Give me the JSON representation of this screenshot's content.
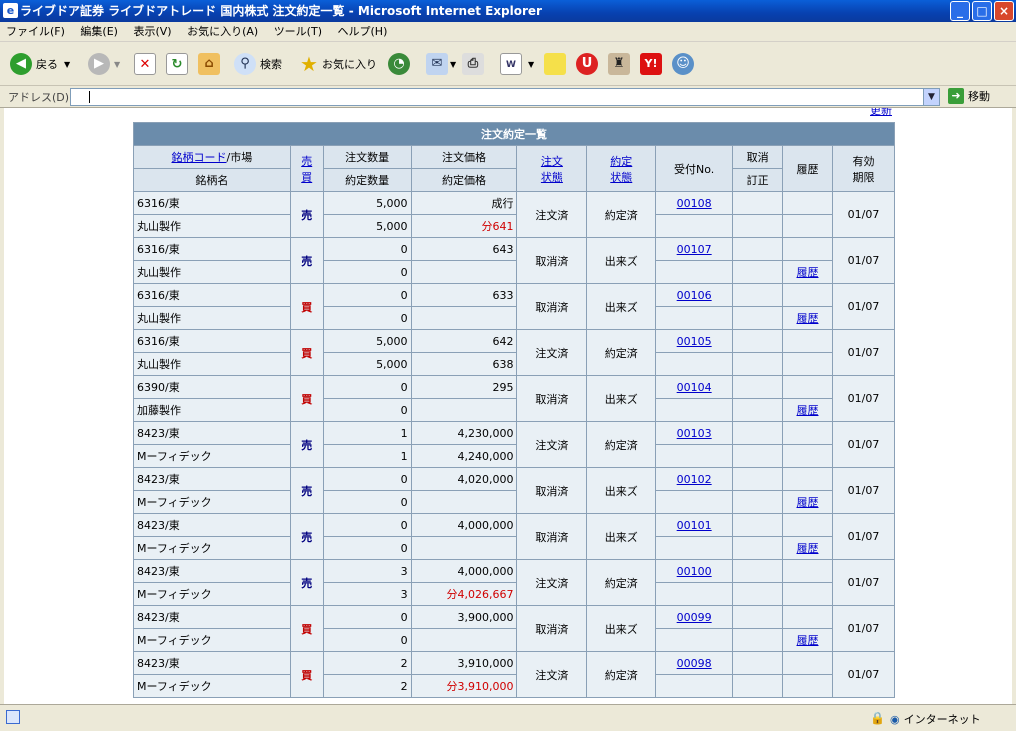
{
  "window": {
    "title": "ライブドア証券 ライブドアトレード 国内株式 注文約定一覧 - Microsoft Internet Explorer"
  },
  "menu": [
    "ファイル(F)",
    "編集(E)",
    "表示(V)",
    "お気に入り(A)",
    "ツール(T)",
    "ヘルプ(H)"
  ],
  "toolbar": {
    "back": "戻る",
    "search": "検索",
    "favorites": "お気に入り"
  },
  "address": {
    "label": "アドレス(D)",
    "value": "",
    "go": "移動"
  },
  "status": {
    "zone": "インターネット"
  },
  "page": {
    "update_link": "更新",
    "table_title": "注文約定一覧",
    "headers": {
      "code_link": "銘柄コード",
      "code_suffix": "/市場",
      "name": "銘柄名",
      "side_a": "売",
      "side_b": "買",
      "order_qty": "注文数量",
      "exec_qty": "約定数量",
      "order_price": "注文価格",
      "exec_price": "約定価格",
      "order_state_a": "注文",
      "order_state_b": "状態",
      "exec_state_a": "約定",
      "exec_state_b": "状態",
      "receipt": "受付No.",
      "cancel": "取消",
      "correct": "訂正",
      "history": "履歴",
      "expiry_a": "有効",
      "expiry_b": "期限"
    },
    "orders": [
      {
        "code": "6316/東",
        "name": "丸山製作",
        "side": "売",
        "order_qty": "5,000",
        "exec_qty": "5,000",
        "order_price": "成行",
        "exec_price": "分641",
        "order_state": "注文済",
        "exec_state": "約定済",
        "receipt": "00108",
        "history": "",
        "expiry": "01/07"
      },
      {
        "code": "6316/東",
        "name": "丸山製作",
        "side": "売",
        "order_qty": "0",
        "exec_qty": "0",
        "order_price": "643",
        "exec_price": "",
        "order_state": "取消済",
        "exec_state": "出来ズ",
        "receipt": "00107",
        "history": "履歴",
        "expiry": "01/07"
      },
      {
        "code": "6316/東",
        "name": "丸山製作",
        "side": "買",
        "order_qty": "0",
        "exec_qty": "0",
        "order_price": "633",
        "exec_price": "",
        "order_state": "取消済",
        "exec_state": "出来ズ",
        "receipt": "00106",
        "history": "履歴",
        "expiry": "01/07"
      },
      {
        "code": "6316/東",
        "name": "丸山製作",
        "side": "買",
        "order_qty": "5,000",
        "exec_qty": "5,000",
        "order_price": "642",
        "exec_price": "638",
        "order_state": "注文済",
        "exec_state": "約定済",
        "receipt": "00105",
        "history": "",
        "expiry": "01/07"
      },
      {
        "code": "6390/東",
        "name": "加藤製作",
        "side": "買",
        "order_qty": "0",
        "exec_qty": "0",
        "order_price": "295",
        "exec_price": "",
        "order_state": "取消済",
        "exec_state": "出来ズ",
        "receipt": "00104",
        "history": "履歴",
        "expiry": "01/07"
      },
      {
        "code": "8423/東",
        "name": "Mーフィデック",
        "side": "売",
        "order_qty": "1",
        "exec_qty": "1",
        "order_price": "4,230,000",
        "exec_price": "4,240,000",
        "order_state": "注文済",
        "exec_state": "約定済",
        "receipt": "00103",
        "history": "",
        "expiry": "01/07"
      },
      {
        "code": "8423/東",
        "name": "Mーフィデック",
        "side": "売",
        "order_qty": "0",
        "exec_qty": "0",
        "order_price": "4,020,000",
        "exec_price": "",
        "order_state": "取消済",
        "exec_state": "出来ズ",
        "receipt": "00102",
        "history": "履歴",
        "expiry": "01/07"
      },
      {
        "code": "8423/東",
        "name": "Mーフィデック",
        "side": "売",
        "order_qty": "0",
        "exec_qty": "0",
        "order_price": "4,000,000",
        "exec_price": "",
        "order_state": "取消済",
        "exec_state": "出来ズ",
        "receipt": "00101",
        "history": "履歴",
        "expiry": "01/07"
      },
      {
        "code": "8423/東",
        "name": "Mーフィデック",
        "side": "売",
        "order_qty": "3",
        "exec_qty": "3",
        "order_price": "4,000,000",
        "exec_price": "分4,026,667",
        "order_state": "注文済",
        "exec_state": "約定済",
        "receipt": "00100",
        "history": "",
        "expiry": "01/07"
      },
      {
        "code": "8423/東",
        "name": "Mーフィデック",
        "side": "買",
        "order_qty": "0",
        "exec_qty": "0",
        "order_price": "3,900,000",
        "exec_price": "",
        "order_state": "取消済",
        "exec_state": "出来ズ",
        "receipt": "00099",
        "history": "履歴",
        "expiry": "01/07"
      },
      {
        "code": "8423/東",
        "name": "Mーフィデック",
        "side": "買",
        "order_qty": "2",
        "exec_qty": "2",
        "order_price": "3,910,000",
        "exec_price": "分3,910,000",
        "order_state": "注文済",
        "exec_state": "約定済",
        "receipt": "00098",
        "history": "",
        "expiry": "01/07"
      }
    ]
  }
}
